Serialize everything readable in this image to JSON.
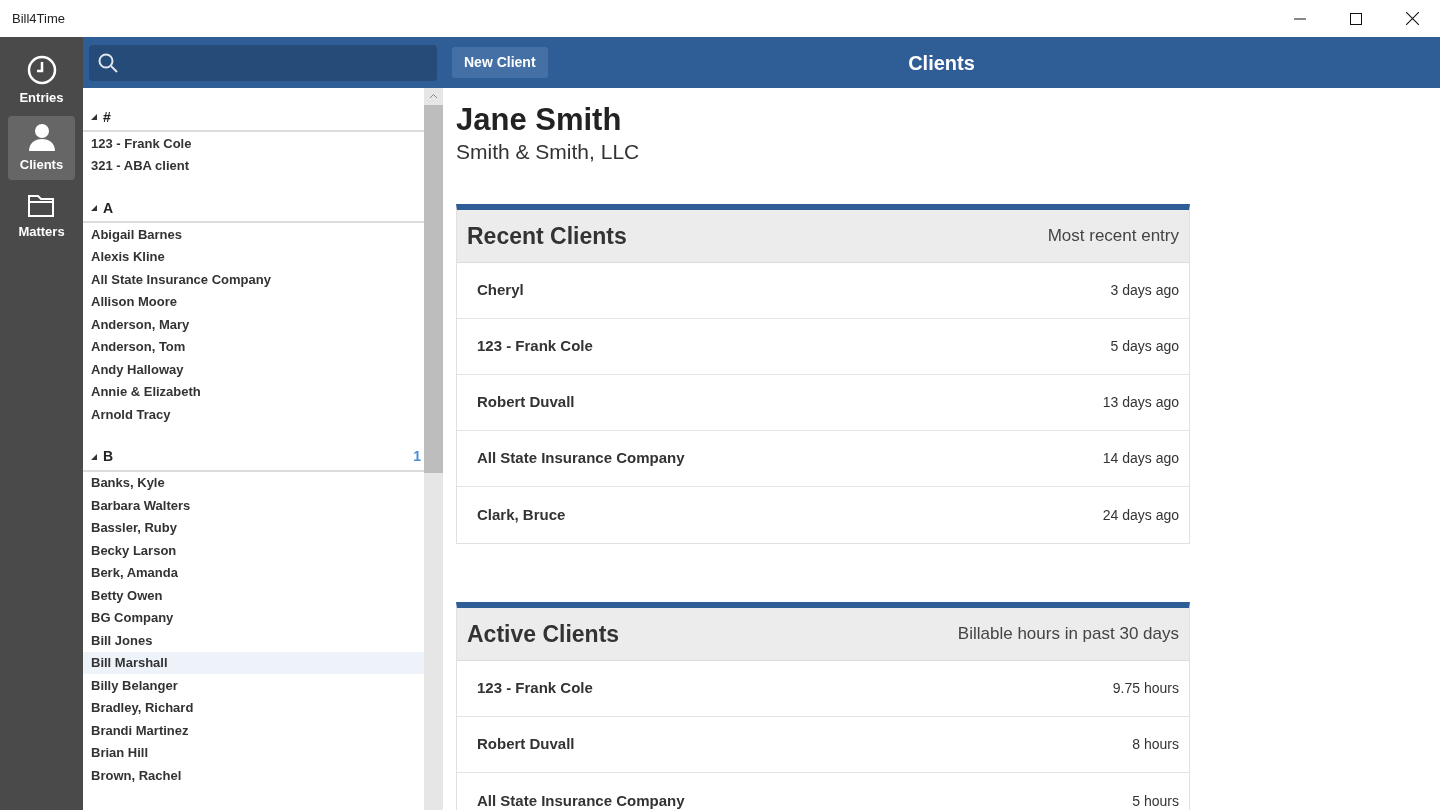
{
  "window": {
    "title": "Bill4Time"
  },
  "nav": [
    {
      "kind": "clock",
      "label": "Entries",
      "selected": false
    },
    {
      "kind": "person",
      "label": "Clients",
      "selected": true
    },
    {
      "kind": "folder",
      "label": "Matters",
      "selected": false
    }
  ],
  "client_list": {
    "groups": [
      {
        "letter": "#",
        "expanded": true,
        "items": [
          {
            "name": "123 - Frank Cole",
            "selected": false
          },
          {
            "name": "321 - ABA client",
            "selected": false
          }
        ]
      },
      {
        "letter": "A",
        "expanded": true,
        "items": [
          {
            "name": "Abigail Barnes",
            "selected": false
          },
          {
            "name": "Alexis Kline",
            "selected": false
          },
          {
            "name": "All State Insurance Company",
            "selected": false
          },
          {
            "name": "Allison Moore",
            "selected": false
          },
          {
            "name": "Anderson, Mary",
            "selected": false
          },
          {
            "name": "Anderson, Tom",
            "selected": false
          },
          {
            "name": "Andy Halloway",
            "selected": false
          },
          {
            "name": "Annie & Elizabeth",
            "selected": false
          },
          {
            "name": "Arnold Tracy",
            "selected": false
          }
        ]
      },
      {
        "letter": "B",
        "expanded": true,
        "count": "1",
        "items": [
          {
            "name": "Banks, Kyle",
            "selected": false
          },
          {
            "name": "Barbara Walters",
            "selected": false
          },
          {
            "name": "Bassler, Ruby",
            "selected": false
          },
          {
            "name": "Becky Larson",
            "selected": false
          },
          {
            "name": "Berk, Amanda",
            "selected": false
          },
          {
            "name": "Betty Owen",
            "selected": false
          },
          {
            "name": "BG Company",
            "selected": false
          },
          {
            "name": "Bill Jones",
            "selected": false
          },
          {
            "name": "Bill Marshall",
            "selected": true
          },
          {
            "name": "Billy Belanger",
            "selected": false
          },
          {
            "name": "Bradley, Richard",
            "selected": false
          },
          {
            "name": "Brandi Martinez",
            "selected": false
          },
          {
            "name": "Brian Hill",
            "selected": false
          },
          {
            "name": "Brown, Rachel",
            "selected": false
          }
        ]
      }
    ]
  },
  "header": {
    "button": "New Client",
    "title": "Clients"
  },
  "client": {
    "name": "Jane Smith",
    "company": "Smith & Smith, LLC"
  },
  "cards": [
    {
      "title": "Recent Clients",
      "subtitle": "Most recent entry",
      "rows": [
        {
          "name": "Cheryl",
          "value": "3 days ago"
        },
        {
          "name": "123 - Frank Cole",
          "value": "5 days ago"
        },
        {
          "name": "Robert Duvall",
          "value": "13 days ago"
        },
        {
          "name": "All State Insurance Company",
          "value": "14 days ago"
        },
        {
          "name": "Clark, Bruce",
          "value": "24 days ago"
        }
      ]
    },
    {
      "title": "Active Clients",
      "subtitle": "Billable hours in past 30 days",
      "rows": [
        {
          "name": "123 - Frank Cole",
          "value": "9.75 hours"
        },
        {
          "name": "Robert Duvall",
          "value": "8 hours"
        },
        {
          "name": "All State Insurance Company",
          "value": "5 hours"
        }
      ]
    }
  ]
}
